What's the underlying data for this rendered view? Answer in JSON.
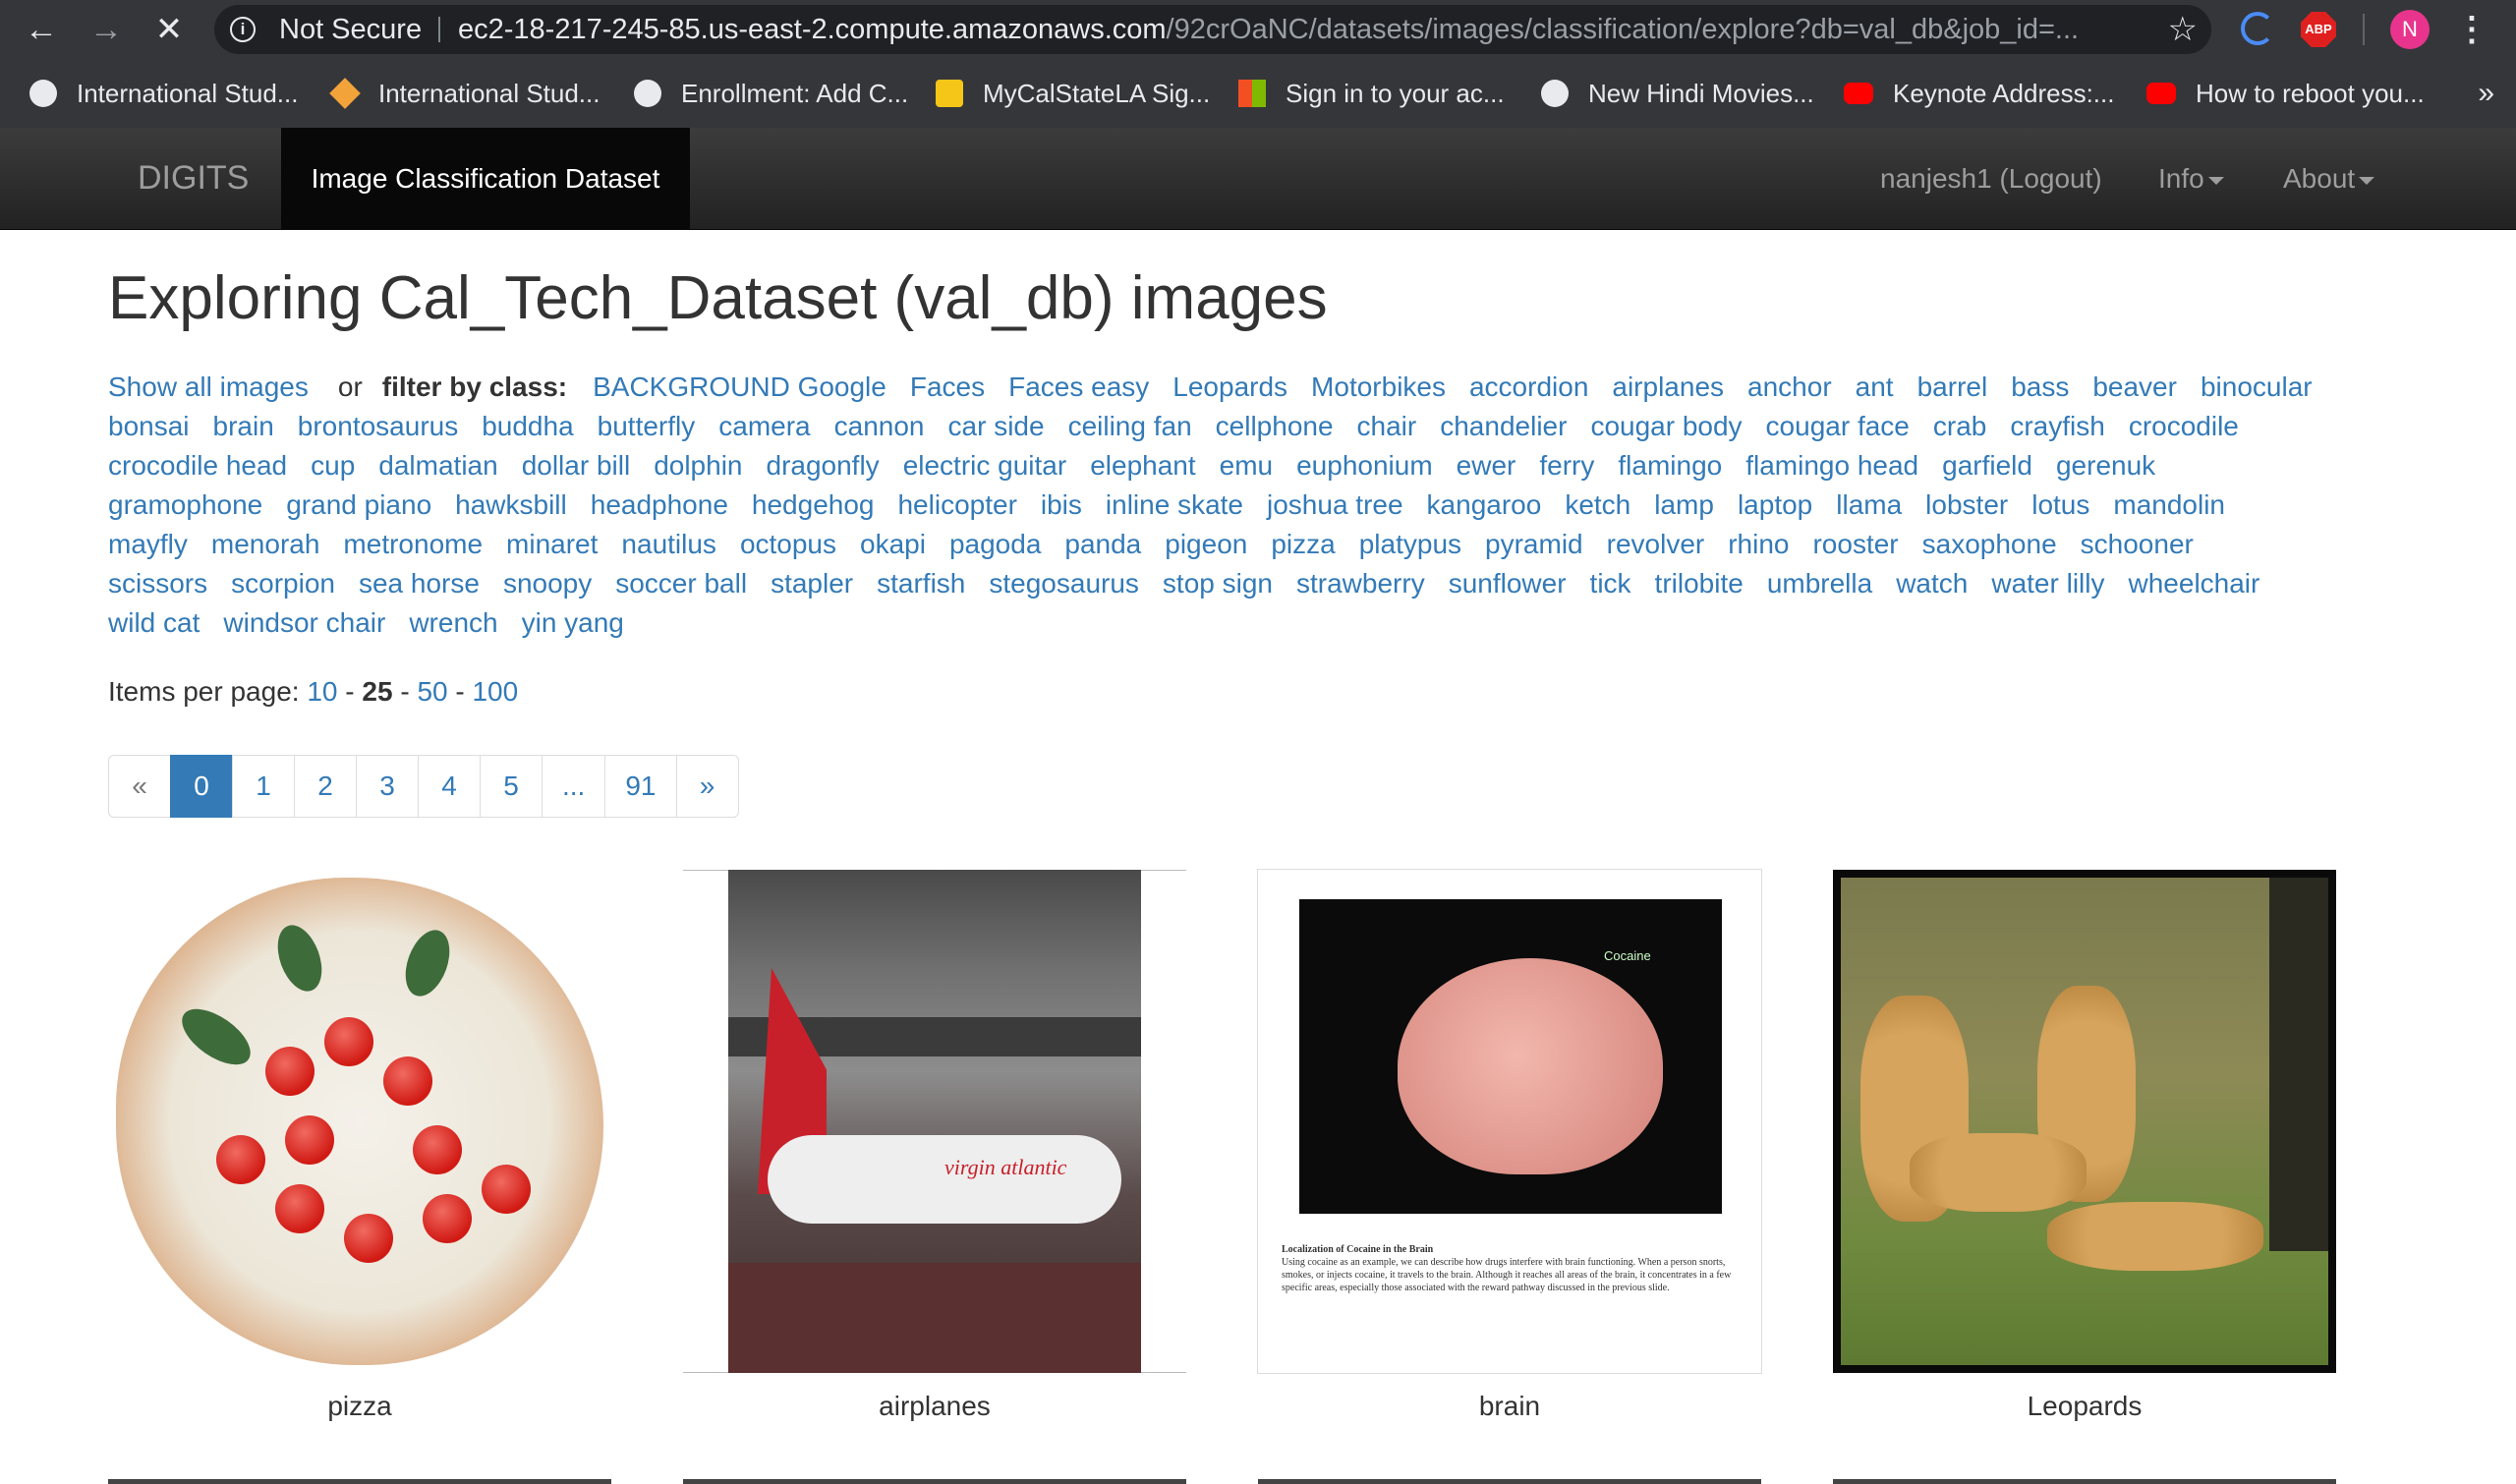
{
  "browser": {
    "nav": {
      "back": "←",
      "forward": "→",
      "stop": "✕"
    },
    "security_label": "Not Secure",
    "url_host": "ec2-18-217-245-85.us-east-2.compute.amazonaws.com",
    "url_path": "/92crOaNC/datasets/images/classification/explore?db=val_db&job_id=...",
    "star": "☆",
    "abp_label": "ABP",
    "profile_initial": "N",
    "menu": "⋮"
  },
  "bookmarks": [
    {
      "label": "International Stud...",
      "icon": "globe-icon"
    },
    {
      "label": "International Stud...",
      "icon": "diamond-icon"
    },
    {
      "label": "Enrollment: Add C...",
      "icon": "globe-icon"
    },
    {
      "label": "MyCalStateLA Sig...",
      "icon": "shield-icon"
    },
    {
      "label": "Sign in to your ac...",
      "icon": "microsoft-icon"
    },
    {
      "label": "New Hindi Movies...",
      "icon": "globe-icon"
    },
    {
      "label": "Keynote Address:...",
      "icon": "youtube-icon"
    },
    {
      "label": "How to reboot you...",
      "icon": "youtube-icon"
    }
  ],
  "bookmarks_more": "»",
  "navbar": {
    "brand": "DIGITS",
    "active_tab": "Image Classification Dataset",
    "user": "nanjesh1 (Logout)",
    "info": "Info",
    "about": "About"
  },
  "page": {
    "title": "Exploring Cal_Tech_Dataset (val_db) images",
    "show_all": "Show all images",
    "or": "or",
    "filter_label": "filter by class:",
    "class_rows": [
      [
        "BACKGROUND Google",
        "Faces",
        "Faces easy",
        "Leopards",
        "Motorbikes",
        "accordion",
        "airplanes",
        "anchor",
        "ant",
        "barrel",
        "bass",
        "beaver",
        "binocular"
      ],
      [
        "bonsai",
        "brain",
        "brontosaurus",
        "buddha",
        "butterfly",
        "camera",
        "cannon",
        "car side",
        "ceiling fan",
        "cellphone",
        "chair",
        "chandelier",
        "cougar body",
        "cougar face",
        "crab",
        "crayfish",
        "crocodile"
      ],
      [
        "crocodile head",
        "cup",
        "dalmatian",
        "dollar bill",
        "dolphin",
        "dragonfly",
        "electric guitar",
        "elephant",
        "emu",
        "euphonium",
        "ewer",
        "ferry",
        "flamingo",
        "flamingo head",
        "garfield",
        "gerenuk"
      ],
      [
        "gramophone",
        "grand piano",
        "hawksbill",
        "headphone",
        "hedgehog",
        "helicopter",
        "ibis",
        "inline skate",
        "joshua tree",
        "kangaroo",
        "ketch",
        "lamp",
        "laptop",
        "llama",
        "lobster",
        "lotus",
        "mandolin"
      ],
      [
        "mayfly",
        "menorah",
        "metronome",
        "minaret",
        "nautilus",
        "octopus",
        "okapi",
        "pagoda",
        "panda",
        "pigeon",
        "pizza",
        "platypus",
        "pyramid",
        "revolver",
        "rhino",
        "rooster",
        "saxophone",
        "schooner"
      ],
      [
        "scissors",
        "scorpion",
        "sea horse",
        "snoopy",
        "soccer ball",
        "stapler",
        "starfish",
        "stegosaurus",
        "stop sign",
        "strawberry",
        "sunflower",
        "tick",
        "trilobite",
        "umbrella",
        "watch",
        "water lilly",
        "wheelchair"
      ],
      [
        "wild cat",
        "windsor chair",
        "wrench",
        "yin yang"
      ]
    ],
    "items_per_page_label": "Items per page:",
    "per_page_options": [
      "10",
      "25",
      "50",
      "100"
    ],
    "per_page_selected": "25",
    "per_page_sep": " - ",
    "pagination": [
      "«",
      "0",
      "1",
      "2",
      "3",
      "4",
      "5",
      "...",
      "91",
      "»"
    ],
    "current_page": "0",
    "images": [
      {
        "caption": "pizza"
      },
      {
        "caption": "airplanes",
        "overlay_text": "virgin atlantic"
      },
      {
        "caption": "brain",
        "overlay_label": "Cocaine",
        "doc_heading": "Localization of Cocaine in the Brain",
        "doc_body": "Using cocaine as an example, we can describe how drugs interfere with brain functioning. When a person snorts, smokes, or injects cocaine, it travels to the brain. Although it reaches all areas of the brain, it concentrates in a few specific areas, especially those associated with the reward pathway discussed in the previous slide."
      },
      {
        "caption": "Leopards"
      }
    ]
  },
  "colors": {
    "link": "#337ab7",
    "navbar": "#222222",
    "chrome": "#35363a"
  }
}
